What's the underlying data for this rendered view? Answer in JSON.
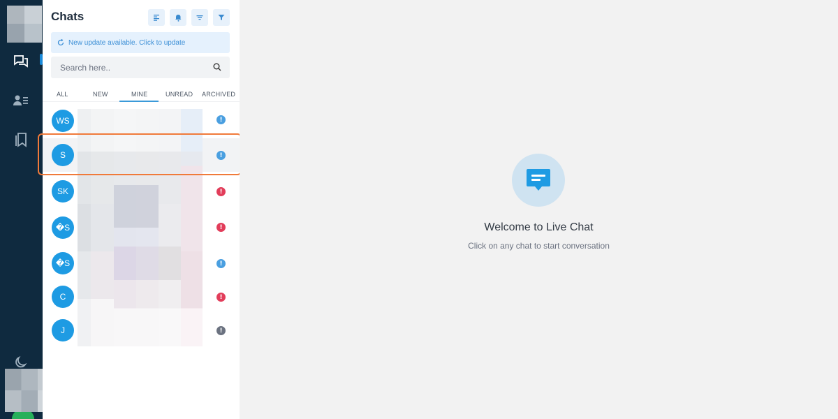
{
  "panel": {
    "title": "Chats",
    "update_notice": "New update available. Click to update",
    "search_placeholder": "Search here.."
  },
  "tabs": [
    {
      "label": "ALL"
    },
    {
      "label": "NEW"
    },
    {
      "label": "MINE"
    },
    {
      "label": "UNREAD"
    },
    {
      "label": "ARCHIVED"
    }
  ],
  "active_tab": "MINE",
  "chats": [
    {
      "initials": "WS",
      "status_color": "#4a9fe0"
    },
    {
      "initials": "S",
      "status_color": "#4a9fe0"
    },
    {
      "initials": "SK",
      "status_color": "#e23d5a"
    },
    {
      "initials": "�S",
      "status_color": "#e23d5a"
    },
    {
      "initials": "�S",
      "status_color": "#4a9fe0"
    },
    {
      "initials": "C",
      "status_color": "#e23d5a"
    },
    {
      "initials": "J",
      "status_color": "#6b7280"
    }
  ],
  "status_glyph": "!",
  "main": {
    "title": "Welcome to Live Chat",
    "subtitle": "Click on any chat to start conversation"
  },
  "colors": {
    "rail": "#0f2a3f",
    "accent": "#1e9be3",
    "selection_outline": "#f07a3a"
  }
}
